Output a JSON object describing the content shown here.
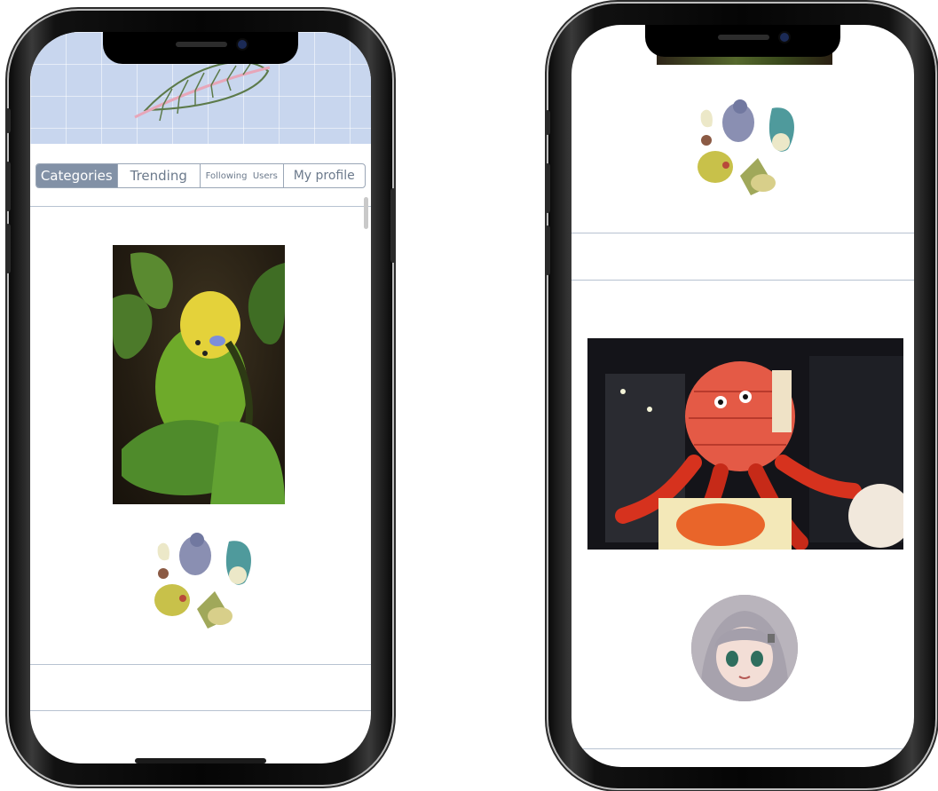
{
  "tabs": {
    "categories": "Categories",
    "trending": "Trending",
    "following": "Following",
    "users": "Users",
    "my_profile": "My profile"
  },
  "active_tab": "Categories",
  "colors": {
    "banner": "#c8d6ee",
    "tab_active_bg": "#8291a6",
    "tab_text": "#6c7a8c",
    "divider": "#b7c2d1"
  },
  "icons": {
    "banner": "feather-illustration",
    "category_art": "birds-illustration",
    "avatar": "anime-avatar"
  }
}
